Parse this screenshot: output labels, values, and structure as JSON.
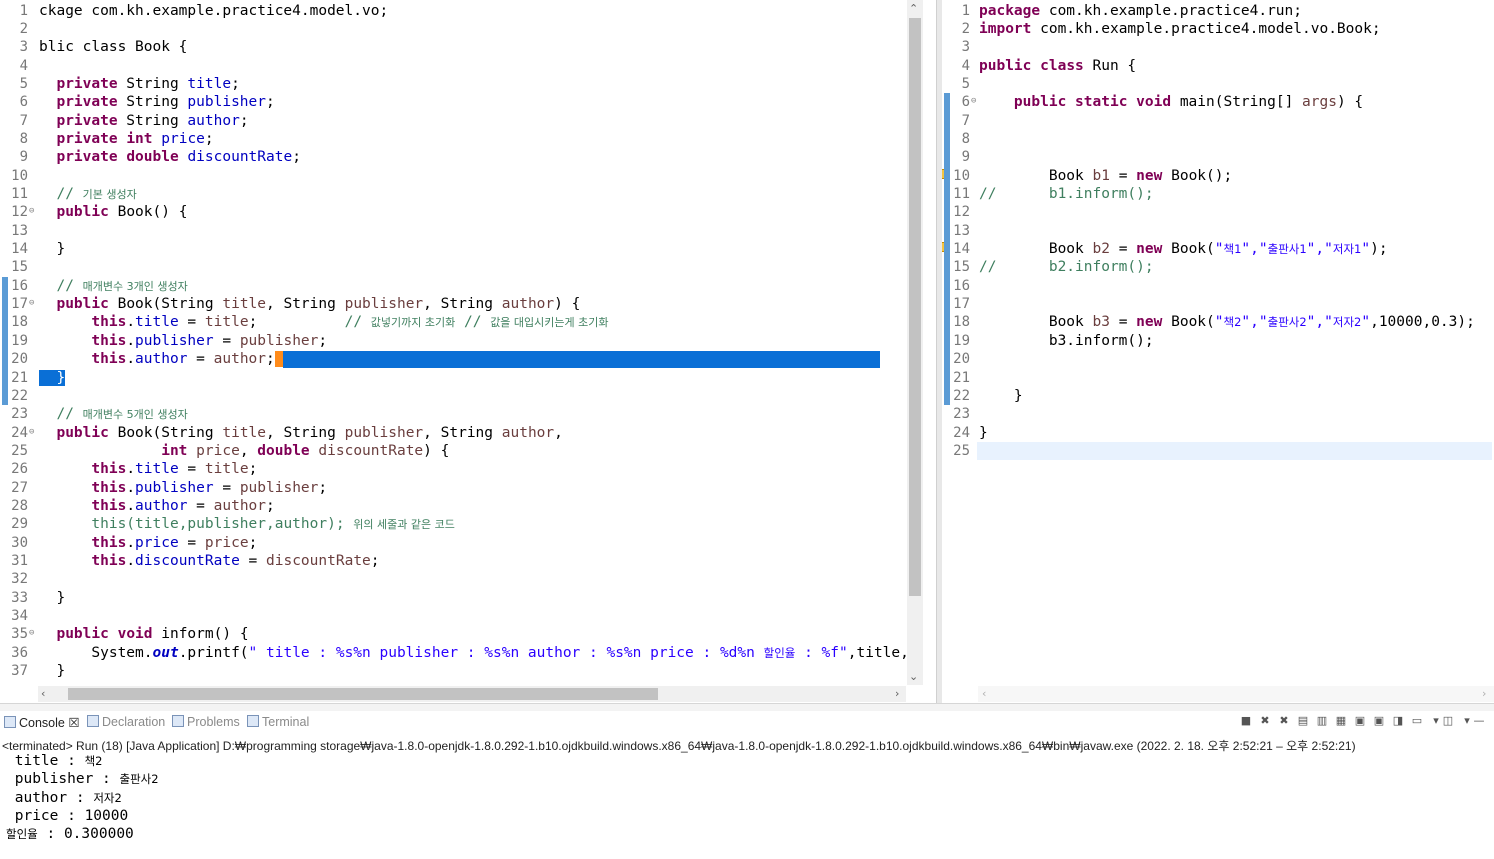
{
  "left_editor": {
    "lines": [
      {
        "n": "1",
        "segs": [
          [
            "ckage com.kh.example.practice4.model.vo;",
            ""
          ]
        ]
      },
      {
        "n": "2",
        "segs": []
      },
      {
        "n": "3",
        "segs": [
          [
            "blic class Book {",
            ""
          ]
        ]
      },
      {
        "n": "4",
        "segs": []
      },
      {
        "n": "5",
        "segs": [
          [
            "  ",
            ""
          ],
          [
            "private",
            "kw"
          ],
          [
            " String ",
            ""
          ],
          [
            "title",
            "fld"
          ],
          [
            ";",
            ""
          ]
        ]
      },
      {
        "n": "6",
        "segs": [
          [
            "  ",
            ""
          ],
          [
            "private",
            "kw"
          ],
          [
            " String ",
            ""
          ],
          [
            "publisher",
            "fld"
          ],
          [
            ";",
            ""
          ]
        ]
      },
      {
        "n": "7",
        "segs": [
          [
            "  ",
            ""
          ],
          [
            "private",
            "kw"
          ],
          [
            " String ",
            ""
          ],
          [
            "author",
            "fld"
          ],
          [
            ";",
            ""
          ]
        ]
      },
      {
        "n": "8",
        "segs": [
          [
            "  ",
            ""
          ],
          [
            "private",
            "kw"
          ],
          [
            " ",
            ""
          ],
          [
            "int",
            "kw"
          ],
          [
            " ",
            ""
          ],
          [
            "price",
            "fld"
          ],
          [
            ";",
            ""
          ]
        ]
      },
      {
        "n": "9",
        "segs": [
          [
            "  ",
            ""
          ],
          [
            "private",
            "kw"
          ],
          [
            " ",
            ""
          ],
          [
            "double",
            "kw"
          ],
          [
            " ",
            ""
          ],
          [
            "discountRate",
            "fld"
          ],
          [
            ";",
            ""
          ]
        ]
      },
      {
        "n": "10",
        "segs": []
      },
      {
        "n": "11",
        "segs": [
          [
            "  ",
            ""
          ],
          [
            "// ",
            "cmt"
          ],
          [
            "기본 생성자",
            "cmt ko-c"
          ]
        ]
      },
      {
        "n": "12",
        "fold": true,
        "segs": [
          [
            "  ",
            ""
          ],
          [
            "public",
            "kw"
          ],
          [
            " Book() {",
            ""
          ]
        ]
      },
      {
        "n": "13",
        "segs": []
      },
      {
        "n": "14",
        "segs": [
          [
            "  }",
            ""
          ]
        ]
      },
      {
        "n": "15",
        "segs": []
      },
      {
        "n": "16",
        "segs": [
          [
            "  ",
            ""
          ],
          [
            "// ",
            "cmt"
          ],
          [
            "매개변수 3개인 생성자",
            "cmt ko-c"
          ]
        ]
      },
      {
        "n": "17",
        "fold": true,
        "segs": [
          [
            "  ",
            ""
          ],
          [
            "public",
            "kw"
          ],
          [
            " Book(String ",
            ""
          ],
          [
            "title",
            "var"
          ],
          [
            ", String ",
            ""
          ],
          [
            "publisher",
            "var"
          ],
          [
            ", String ",
            ""
          ],
          [
            "author",
            "var"
          ],
          [
            ") {",
            ""
          ]
        ]
      },
      {
        "n": "18",
        "segs": [
          [
            "      ",
            ""
          ],
          [
            "this",
            "kw"
          ],
          [
            ".",
            ""
          ],
          [
            "title",
            "fld"
          ],
          [
            " = ",
            ""
          ],
          [
            "title",
            "var"
          ],
          [
            ";          ",
            ""
          ],
          [
            "// ",
            "cmt"
          ],
          [
            "값넣기까지 초기화",
            "cmt ko-c"
          ],
          [
            " // ",
            "cmt"
          ],
          [
            "값을 대입시키는게 초기화",
            "cmt ko-c"
          ]
        ]
      },
      {
        "n": "19",
        "segs": [
          [
            "      ",
            ""
          ],
          [
            "this",
            "kw"
          ],
          [
            ".",
            ""
          ],
          [
            "publisher",
            "fld"
          ],
          [
            " = ",
            ""
          ],
          [
            "publisher",
            "var"
          ],
          [
            ";",
            ""
          ]
        ]
      },
      {
        "n": "20",
        "selected": true,
        "segs": [
          [
            "      ",
            ""
          ],
          [
            "this",
            "kw"
          ],
          [
            ".",
            ""
          ],
          [
            "author",
            "fld"
          ],
          [
            " = ",
            ""
          ],
          [
            "author",
            "var"
          ],
          [
            ";",
            ""
          ]
        ]
      },
      {
        "n": "21",
        "segs": [
          [
            "  }",
            "sel"
          ]
        ]
      },
      {
        "n": "22",
        "segs": []
      },
      {
        "n": "23",
        "segs": [
          [
            "  ",
            ""
          ],
          [
            "// ",
            "cmt"
          ],
          [
            "매개변수 5개인 생성자",
            "cmt ko-c"
          ]
        ]
      },
      {
        "n": "24",
        "fold": true,
        "segs": [
          [
            "  ",
            ""
          ],
          [
            "public",
            "kw"
          ],
          [
            " Book(String ",
            ""
          ],
          [
            "title",
            "var"
          ],
          [
            ", String ",
            ""
          ],
          [
            "publisher",
            "var"
          ],
          [
            ", String ",
            ""
          ],
          [
            "author",
            "var"
          ],
          [
            ",",
            ""
          ]
        ]
      },
      {
        "n": "25",
        "segs": [
          [
            "              ",
            ""
          ],
          [
            "int",
            "kw"
          ],
          [
            " ",
            ""
          ],
          [
            "price",
            "var"
          ],
          [
            ", ",
            ""
          ],
          [
            "double",
            "kw"
          ],
          [
            " ",
            ""
          ],
          [
            "discountRate",
            "var"
          ],
          [
            ") {",
            ""
          ]
        ]
      },
      {
        "n": "26",
        "segs": [
          [
            "      ",
            ""
          ],
          [
            "this",
            "kw"
          ],
          [
            ".",
            ""
          ],
          [
            "title",
            "fld"
          ],
          [
            " = ",
            ""
          ],
          [
            "title",
            "var"
          ],
          [
            ";",
            ""
          ]
        ]
      },
      {
        "n": "27",
        "segs": [
          [
            "      ",
            ""
          ],
          [
            "this",
            "kw"
          ],
          [
            ".",
            ""
          ],
          [
            "publisher",
            "fld"
          ],
          [
            " = ",
            ""
          ],
          [
            "publisher",
            "var"
          ],
          [
            ";",
            ""
          ]
        ]
      },
      {
        "n": "28",
        "segs": [
          [
            "      ",
            ""
          ],
          [
            "this",
            "kw"
          ],
          [
            ".",
            ""
          ],
          [
            "author",
            "fld"
          ],
          [
            " = ",
            ""
          ],
          [
            "author",
            "var"
          ],
          [
            ";",
            ""
          ]
        ]
      },
      {
        "n": "29",
        "segs": [
          [
            "      ",
            ""
          ],
          [
            "this(title,publisher,author); ",
            "cmt"
          ],
          [
            "위의 세줄과 같은 코드",
            "cmt ko-c"
          ]
        ]
      },
      {
        "n": "30",
        "segs": [
          [
            "      ",
            ""
          ],
          [
            "this",
            "kw"
          ],
          [
            ".",
            ""
          ],
          [
            "price",
            "fld"
          ],
          [
            " = ",
            ""
          ],
          [
            "price",
            "var"
          ],
          [
            ";",
            ""
          ]
        ]
      },
      {
        "n": "31",
        "segs": [
          [
            "      ",
            ""
          ],
          [
            "this",
            "kw"
          ],
          [
            ".",
            ""
          ],
          [
            "discountRate",
            "fld"
          ],
          [
            " = ",
            ""
          ],
          [
            "discountRate",
            "var"
          ],
          [
            ";",
            ""
          ]
        ]
      },
      {
        "n": "32",
        "segs": []
      },
      {
        "n": "33",
        "segs": [
          [
            "  }",
            ""
          ]
        ]
      },
      {
        "n": "34",
        "segs": []
      },
      {
        "n": "35",
        "fold": true,
        "segs": [
          [
            "  ",
            ""
          ],
          [
            "public",
            "kw"
          ],
          [
            " ",
            ""
          ],
          [
            "void",
            "kw"
          ],
          [
            " inform() {",
            ""
          ]
        ]
      },
      {
        "n": "36",
        "segs": [
          [
            "      System.",
            ""
          ],
          [
            "out",
            "stat"
          ],
          [
            ".printf(",
            ""
          ],
          [
            "\" title : %s%n publisher : %s%n author : %s%n price : %d%n ",
            "str"
          ],
          [
            "할인율",
            "str ko"
          ],
          [
            " : %f\"",
            "str"
          ],
          [
            ",title,",
            ""
          ]
        ]
      },
      {
        "n": "37",
        "segs": [
          [
            "  }",
            ""
          ]
        ]
      }
    ]
  },
  "right_editor": {
    "lines": [
      {
        "n": "1",
        "segs": [
          [
            "package",
            "kw"
          ],
          [
            " com.kh.example.practice4.run;",
            ""
          ]
        ]
      },
      {
        "n": "2",
        "segs": [
          [
            "import",
            "kw"
          ],
          [
            " com.kh.example.practice4.model.vo.Book;",
            ""
          ]
        ]
      },
      {
        "n": "3",
        "segs": []
      },
      {
        "n": "4",
        "segs": [
          [
            "public",
            "kw"
          ],
          [
            " ",
            ""
          ],
          [
            "class",
            "kw"
          ],
          [
            " Run {",
            ""
          ]
        ]
      },
      {
        "n": "5",
        "segs": []
      },
      {
        "n": "6",
        "fold": true,
        "segs": [
          [
            "    ",
            ""
          ],
          [
            "public",
            "kw"
          ],
          [
            " ",
            ""
          ],
          [
            "static",
            "kw"
          ],
          [
            " ",
            ""
          ],
          [
            "void",
            "kw"
          ],
          [
            " main(String[] ",
            ""
          ],
          [
            "args",
            "var"
          ],
          [
            ") {",
            ""
          ]
        ]
      },
      {
        "n": "7",
        "segs": []
      },
      {
        "n": "8",
        "segs": []
      },
      {
        "n": "9",
        "segs": []
      },
      {
        "n": "10",
        "warn": true,
        "segs": [
          [
            "        Book ",
            ""
          ],
          [
            "b1",
            "var"
          ],
          [
            " = ",
            ""
          ],
          [
            "new",
            "kw"
          ],
          [
            " Book();",
            ""
          ]
        ]
      },
      {
        "n": "11",
        "segs": [
          [
            "//      b1.inform();",
            "cmt"
          ]
        ]
      },
      {
        "n": "12",
        "segs": []
      },
      {
        "n": "13",
        "segs": []
      },
      {
        "n": "14",
        "warn": true,
        "segs": [
          [
            "        Book ",
            ""
          ],
          [
            "b2",
            "var"
          ],
          [
            " = ",
            ""
          ],
          [
            "new",
            "kw"
          ],
          [
            " Book(",
            ""
          ],
          [
            "\"",
            "str"
          ],
          [
            "책1",
            "str ko"
          ],
          [
            "\",\"",
            "str"
          ],
          [
            "출판사1",
            "str ko"
          ],
          [
            "\",\"",
            "str"
          ],
          [
            "저자1",
            "str ko"
          ],
          [
            "\"",
            "str"
          ],
          [
            ");",
            ""
          ]
        ]
      },
      {
        "n": "15",
        "segs": [
          [
            "//      b2.inform();",
            "cmt"
          ]
        ]
      },
      {
        "n": "16",
        "segs": []
      },
      {
        "n": "17",
        "segs": []
      },
      {
        "n": "18",
        "segs": [
          [
            "        Book ",
            ""
          ],
          [
            "b3",
            "var"
          ],
          [
            " = ",
            ""
          ],
          [
            "new",
            "kw"
          ],
          [
            " Book(",
            ""
          ],
          [
            "\"",
            "str"
          ],
          [
            "책2",
            "str ko"
          ],
          [
            "\",\"",
            "str"
          ],
          [
            "출판사2",
            "str ko"
          ],
          [
            "\",\"",
            "str"
          ],
          [
            "저자2",
            "str ko"
          ],
          [
            "\"",
            "str"
          ],
          [
            ",10000,0.3);",
            ""
          ]
        ]
      },
      {
        "n": "19",
        "segs": [
          [
            "        b3.inform();",
            ""
          ]
        ]
      },
      {
        "n": "20",
        "segs": []
      },
      {
        "n": "21",
        "segs": []
      },
      {
        "n": "22",
        "segs": [
          [
            "    }",
            ""
          ]
        ]
      },
      {
        "n": "23",
        "segs": []
      },
      {
        "n": "24",
        "segs": [
          [
            "}",
            ""
          ]
        ]
      },
      {
        "n": "25",
        "current": true,
        "segs": []
      }
    ]
  },
  "console": {
    "tabs": [
      {
        "label": "Console ☒",
        "active": true,
        "icon": "console-icon"
      },
      {
        "label": "Declaration",
        "active": false,
        "icon": "declaration-icon"
      },
      {
        "label": "Problems",
        "active": false,
        "icon": "problems-icon"
      },
      {
        "label": "Terminal",
        "active": false,
        "icon": "terminal-icon"
      }
    ],
    "status": "<terminated> Run (18) [Java Application] D:₩programming storage₩java-1.8.0-openjdk-1.8.0.292-1.b10.ojdkbuild.windows.x86_64₩java-1.8.0-openjdk-1.8.0.292-1.b10.ojdkbuild.windows.x86_64₩bin₩javaw.exe  (2022. 2. 18. 오후 2:52:21 – 오후 2:52:21)",
    "output": [
      [
        [
          " title : ",
          ""
        ],
        [
          "책2",
          "ko"
        ]
      ],
      [
        [
          " publisher : ",
          ""
        ],
        [
          "출판사2",
          "ko"
        ]
      ],
      [
        [
          " author : ",
          ""
        ],
        [
          "저자2",
          "ko"
        ]
      ],
      [
        [
          " price : 10000",
          ""
        ]
      ],
      [
        [
          "할인율",
          "ko"
        ],
        [
          " : 0.300000",
          ""
        ]
      ]
    ],
    "toolbar_icons": [
      "stop-icon",
      "remove-launch-icon",
      "remove-all-icon",
      "clear-console-icon",
      "scroll-lock-icon",
      "word-wrap-icon",
      "show-on-stdout-icon",
      "show-on-stderr-icon",
      "pin-console-icon",
      "display-console-icon",
      "dropdown-icon",
      "open-console-icon",
      "dropdown-icon",
      "minimize-icon"
    ]
  }
}
